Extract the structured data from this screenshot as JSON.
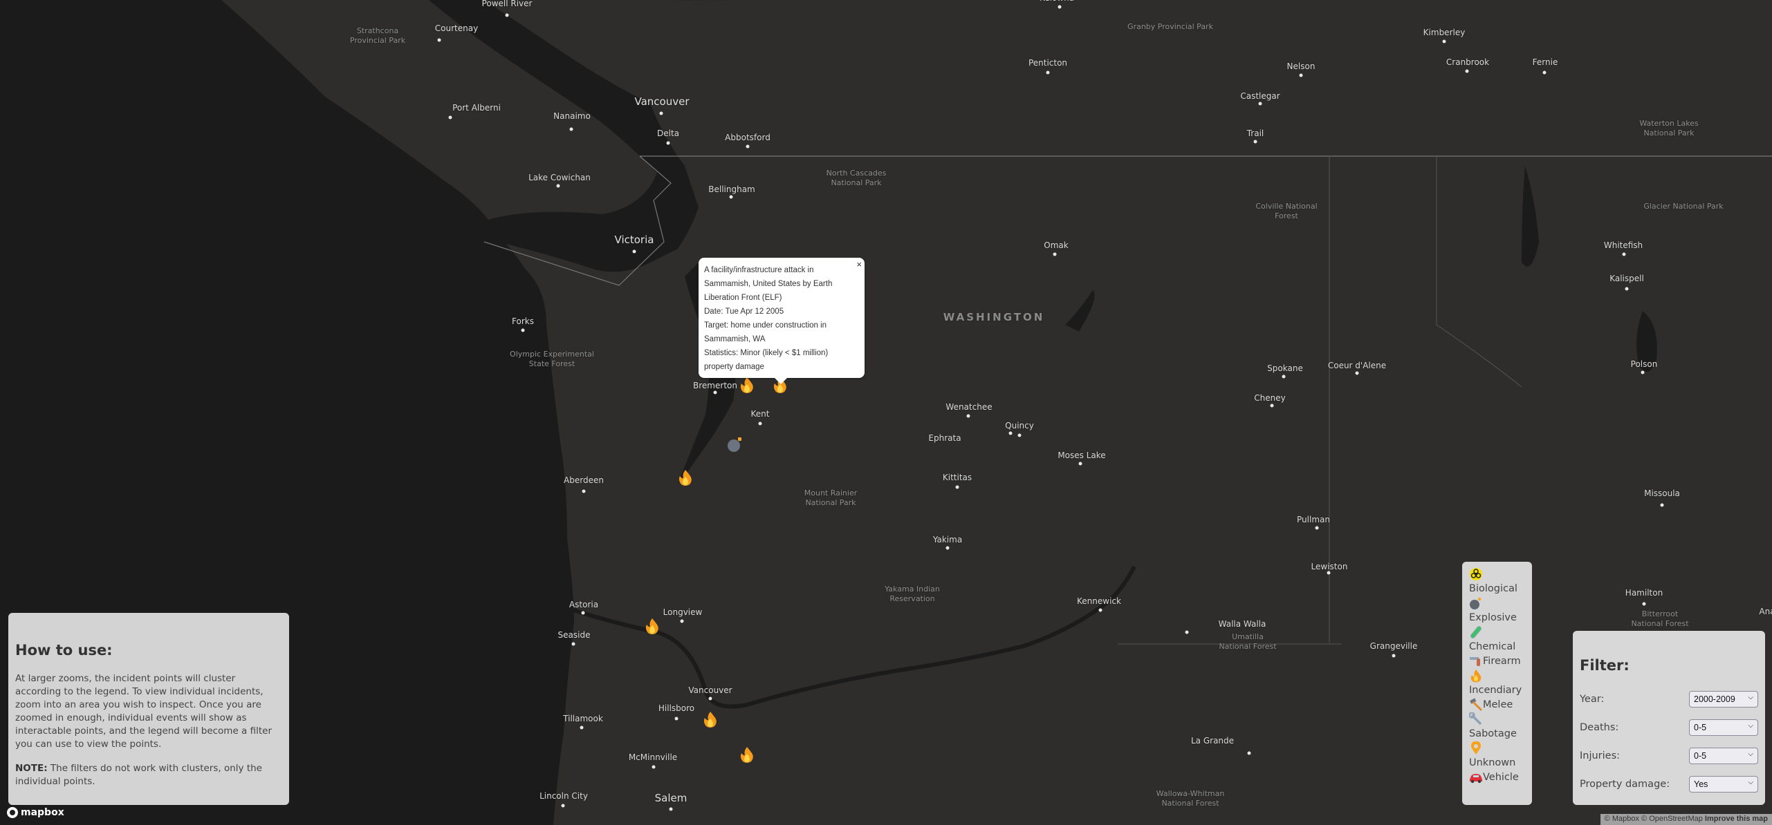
{
  "map": {
    "background": "#2e2d2c",
    "water": "#1b1b1b",
    "places": [
      {
        "name": "Powell River",
        "type": "city",
        "dot": true
      },
      {
        "name": "Courtenay",
        "type": "city",
        "dot": true
      },
      {
        "name": "Strathcona\nProvincial Park",
        "type": "park"
      },
      {
        "name": "Port Alberni",
        "type": "city",
        "dot": true
      },
      {
        "name": "Nanaimo",
        "type": "city",
        "dot": true
      },
      {
        "name": "Vancouver",
        "type": "big",
        "dot": true
      },
      {
        "name": "Delta",
        "type": "city",
        "dot": true
      },
      {
        "name": "Abbotsford",
        "type": "city",
        "dot": true
      },
      {
        "name": "Provincial Park",
        "type": "park"
      },
      {
        "name": "Kelowna",
        "type": "city",
        "dot": true
      },
      {
        "name": "Granby Provincial Park",
        "type": "park"
      },
      {
        "name": "Penticton",
        "type": "city",
        "dot": true
      },
      {
        "name": "Nelson",
        "type": "city",
        "dot": true
      },
      {
        "name": "Castlegar",
        "type": "city",
        "dot": true
      },
      {
        "name": "Trail",
        "type": "city",
        "dot": true
      },
      {
        "name": "Kimberley",
        "type": "city",
        "dot": true
      },
      {
        "name": "Cranbrook",
        "type": "city",
        "dot": true
      },
      {
        "name": "Fernie",
        "type": "city",
        "dot": true
      },
      {
        "name": "Waterton Lakes\nNational Park",
        "type": "park"
      },
      {
        "name": "Glacier National Park",
        "type": "park"
      },
      {
        "name": "Whitefish",
        "type": "city",
        "dot": true
      },
      {
        "name": "Kalispell",
        "type": "city",
        "dot": true
      },
      {
        "name": "Polson",
        "type": "city",
        "dot": true
      },
      {
        "name": "Missoula",
        "type": "city",
        "dot": true
      },
      {
        "name": "Hamilton",
        "type": "city",
        "dot": true
      },
      {
        "name": "Bitterroot\nNational Forest",
        "type": "park"
      },
      {
        "name": "Ana",
        "type": "city"
      },
      {
        "name": "Lake Cowichan",
        "type": "city",
        "dot": true
      },
      {
        "name": "Bellingham",
        "type": "city",
        "dot": true
      },
      {
        "name": "North Cascades\nNational Park",
        "type": "park"
      },
      {
        "name": "Victoria",
        "type": "big",
        "dot": true
      },
      {
        "name": "Forks",
        "type": "city",
        "dot": true
      },
      {
        "name": "Olympic Experimental\nState Forest",
        "type": "park"
      },
      {
        "name": "Omak",
        "type": "city",
        "dot": true
      },
      {
        "name": "WASHINGTON",
        "type": "state"
      },
      {
        "name": "Colville National\nForest",
        "type": "park"
      },
      {
        "name": "Bremerton",
        "type": "city",
        "dot": true
      },
      {
        "name": "Kent",
        "type": "city",
        "dot": true
      },
      {
        "name": "Aberdeen",
        "type": "city",
        "dot": true
      },
      {
        "name": "Mount Rainier\nNational Park",
        "type": "park"
      },
      {
        "name": "Wenatchee",
        "type": "city",
        "dot": true
      },
      {
        "name": "Quincy",
        "type": "city",
        "dot": true
      },
      {
        "name": "Ephrata",
        "type": "city",
        "dot": true
      },
      {
        "name": "Moses Lake",
        "type": "city",
        "dot": true
      },
      {
        "name": "Kittitas",
        "type": "city",
        "dot": true
      },
      {
        "name": "Yakima",
        "type": "city",
        "dot": true
      },
      {
        "name": "Spokane",
        "type": "city",
        "dot": true
      },
      {
        "name": "Coeur d'Alene",
        "type": "city",
        "dot": true
      },
      {
        "name": "Cheney",
        "type": "city",
        "dot": true
      },
      {
        "name": "Pullman",
        "type": "city",
        "dot": true
      },
      {
        "name": "Lewiston",
        "type": "city",
        "dot": true
      },
      {
        "name": "Grangeville",
        "type": "city",
        "dot": true
      },
      {
        "name": "Yakama Indian\nReservation",
        "type": "park"
      },
      {
        "name": "Kennewick",
        "type": "city",
        "dot": true
      },
      {
        "name": "Walla Walla",
        "type": "city",
        "dot": true
      },
      {
        "name": "Umatilla\nNational Forest",
        "type": "park"
      },
      {
        "name": "La Grande",
        "type": "city",
        "dot": true
      },
      {
        "name": "Wallowa-Whitman\nNational Forest",
        "type": "park"
      },
      {
        "name": "Astoria",
        "type": "city",
        "dot": true
      },
      {
        "name": "Longview",
        "type": "city",
        "dot": true
      },
      {
        "name": "Seaside",
        "type": "city",
        "dot": true
      },
      {
        "name": "Vancouver",
        "type": "city",
        "dot": true
      },
      {
        "name": "Hillsboro",
        "type": "city",
        "dot": true
      },
      {
        "name": "Tillamook",
        "type": "city",
        "dot": true
      },
      {
        "name": "McMinnville",
        "type": "city",
        "dot": true
      },
      {
        "name": "Salem",
        "type": "big",
        "dot": true
      },
      {
        "name": "Lincoln City",
        "type": "city",
        "dot": true
      }
    ],
    "markers": [
      {
        "type": "incendiary",
        "icon": "fire-icon"
      },
      {
        "type": "incendiary",
        "icon": "fire-icon",
        "selected": true
      },
      {
        "type": "explosive",
        "icon": "bomb-icon"
      },
      {
        "type": "incendiary",
        "icon": "fire-icon"
      },
      {
        "type": "incendiary",
        "icon": "fire-icon"
      },
      {
        "type": "incendiary",
        "icon": "fire-icon"
      },
      {
        "type": "incendiary",
        "icon": "fire-icon"
      }
    ]
  },
  "popup": {
    "close_label": "×",
    "lines": [
      "A facility/infrastructure attack in Sammamish, United States by Earth Liberation Front (ELF)",
      "Date: Tue Apr 12 2005",
      "Target: home under construction in Sammamish, WA",
      "Statistics: Minor (likely < $1 million) property damage"
    ]
  },
  "howto": {
    "title": "How to use:",
    "body": "At larger zooms, the incident points will cluster according to the legend. To view individual incidents, zoom into an area you wish to inspect. Once you are zoomed in enough, individual events will show as interactable points, and the legend will become a filter you can use to view the points.",
    "note_label": "NOTE:",
    "note_text": " The filters do not work with clusters, only the individual points."
  },
  "legend": {
    "items": [
      {
        "label": "Biological",
        "icon": "biohazard-icon",
        "color": "#f5e000"
      },
      {
        "label": "Explosive",
        "icon": "bomb-icon",
        "color": "#5f6670"
      },
      {
        "label": "Chemical",
        "icon": "test-tube-icon",
        "color": "#3fbf6a"
      },
      {
        "label": "Firearm",
        "icon": "pistol-icon",
        "color": "#8fa3b8"
      },
      {
        "label": "Incendiary",
        "icon": "fire-icon",
        "color": "#f59b1c"
      },
      {
        "label": "Melee",
        "icon": "hammer-icon",
        "color": "#e08a2c"
      },
      {
        "label": "Sabotage",
        "icon": "wrench-icon",
        "color": "#8ea2b6"
      },
      {
        "label": "Unknown",
        "icon": "pin-icon",
        "color": "#f7a21b"
      },
      {
        "label": "Vehicle",
        "icon": "car-icon",
        "color": "#e0313b"
      }
    ]
  },
  "filter": {
    "title": "Filter:",
    "fields": [
      {
        "label": "Year:",
        "value": "2000-2009"
      },
      {
        "label": "Deaths:",
        "value": "0-5"
      },
      {
        "label": "Injuries:",
        "value": "0-5"
      },
      {
        "label": "Property damage:",
        "value": "Yes"
      }
    ]
  },
  "branding": {
    "logo_text": "mapbox"
  },
  "attribution": {
    "mapbox": "© Mapbox",
    "osm": "© OpenStreetMap",
    "improve": "Improve this map"
  }
}
